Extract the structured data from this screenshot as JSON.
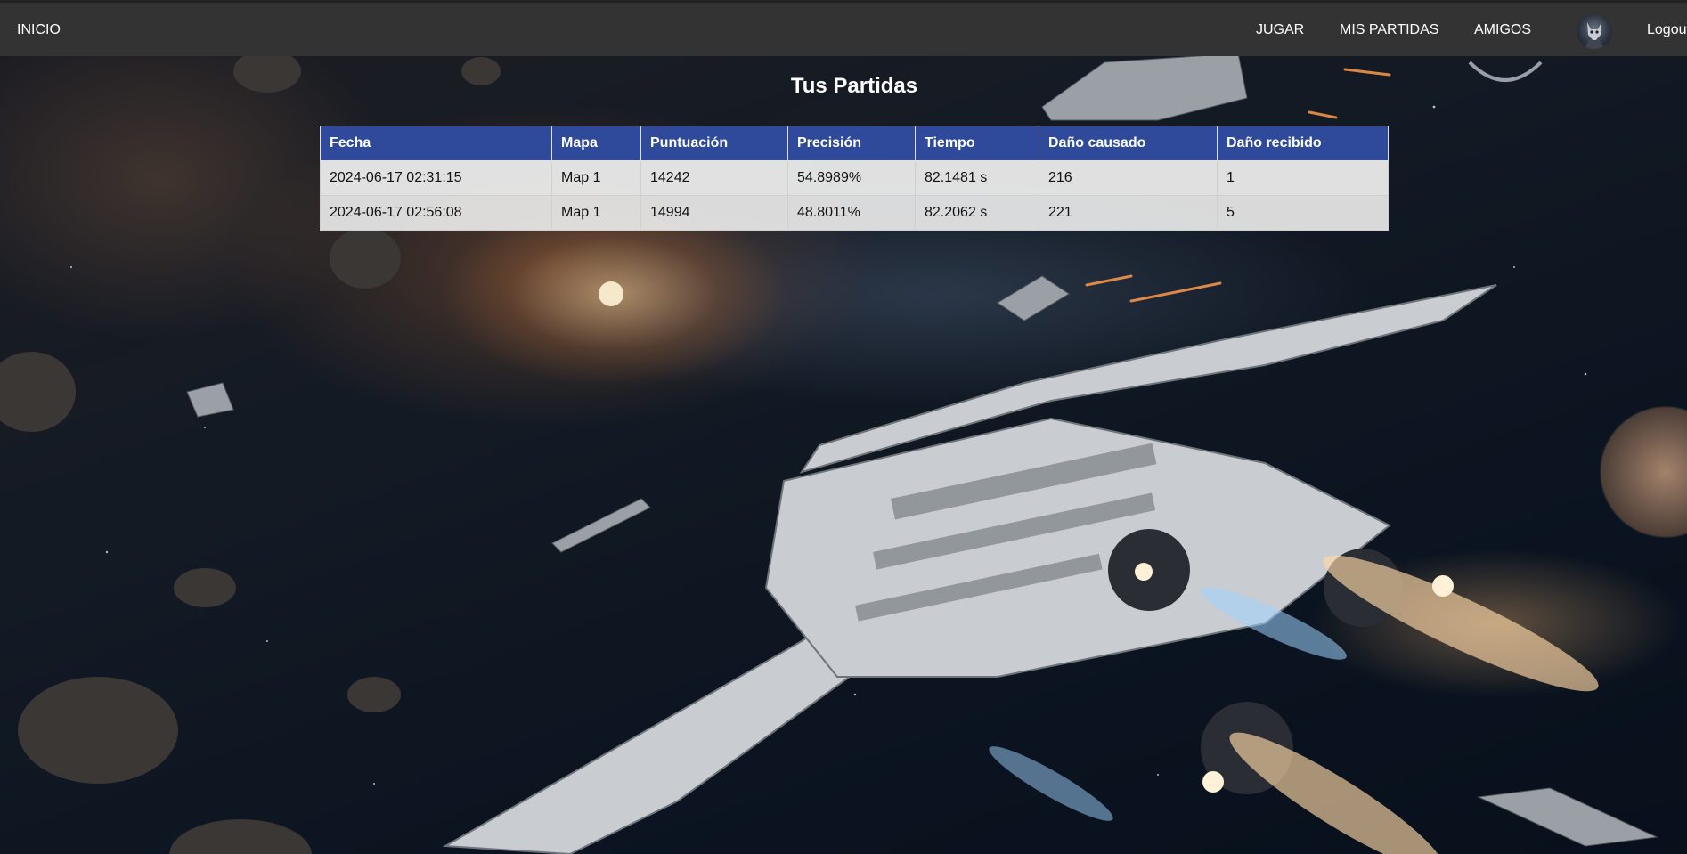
{
  "nav": {
    "home": "INICIO",
    "play": "JUGAR",
    "my_games": "MIS PARTIDAS",
    "friends": "AMIGOS",
    "logout": "Logout"
  },
  "page": {
    "title": "Tus Partidas"
  },
  "table": {
    "headers": [
      "Fecha",
      "Mapa",
      "Puntuación",
      "Precisión",
      "Tiempo",
      "Daño causado",
      "Daño recibido"
    ],
    "rows": [
      [
        "2024-06-17 02:31:15",
        "Map 1",
        "14242",
        "54.8989%",
        "82.1481 s",
        "216",
        "1"
      ],
      [
        "2024-06-17 02:56:08",
        "Map 1",
        "14994",
        "48.8011%",
        "82.2062 s",
        "221",
        "5"
      ]
    ]
  },
  "colors": {
    "navbar": "#333333",
    "table_header": "#2f4a9a"
  }
}
